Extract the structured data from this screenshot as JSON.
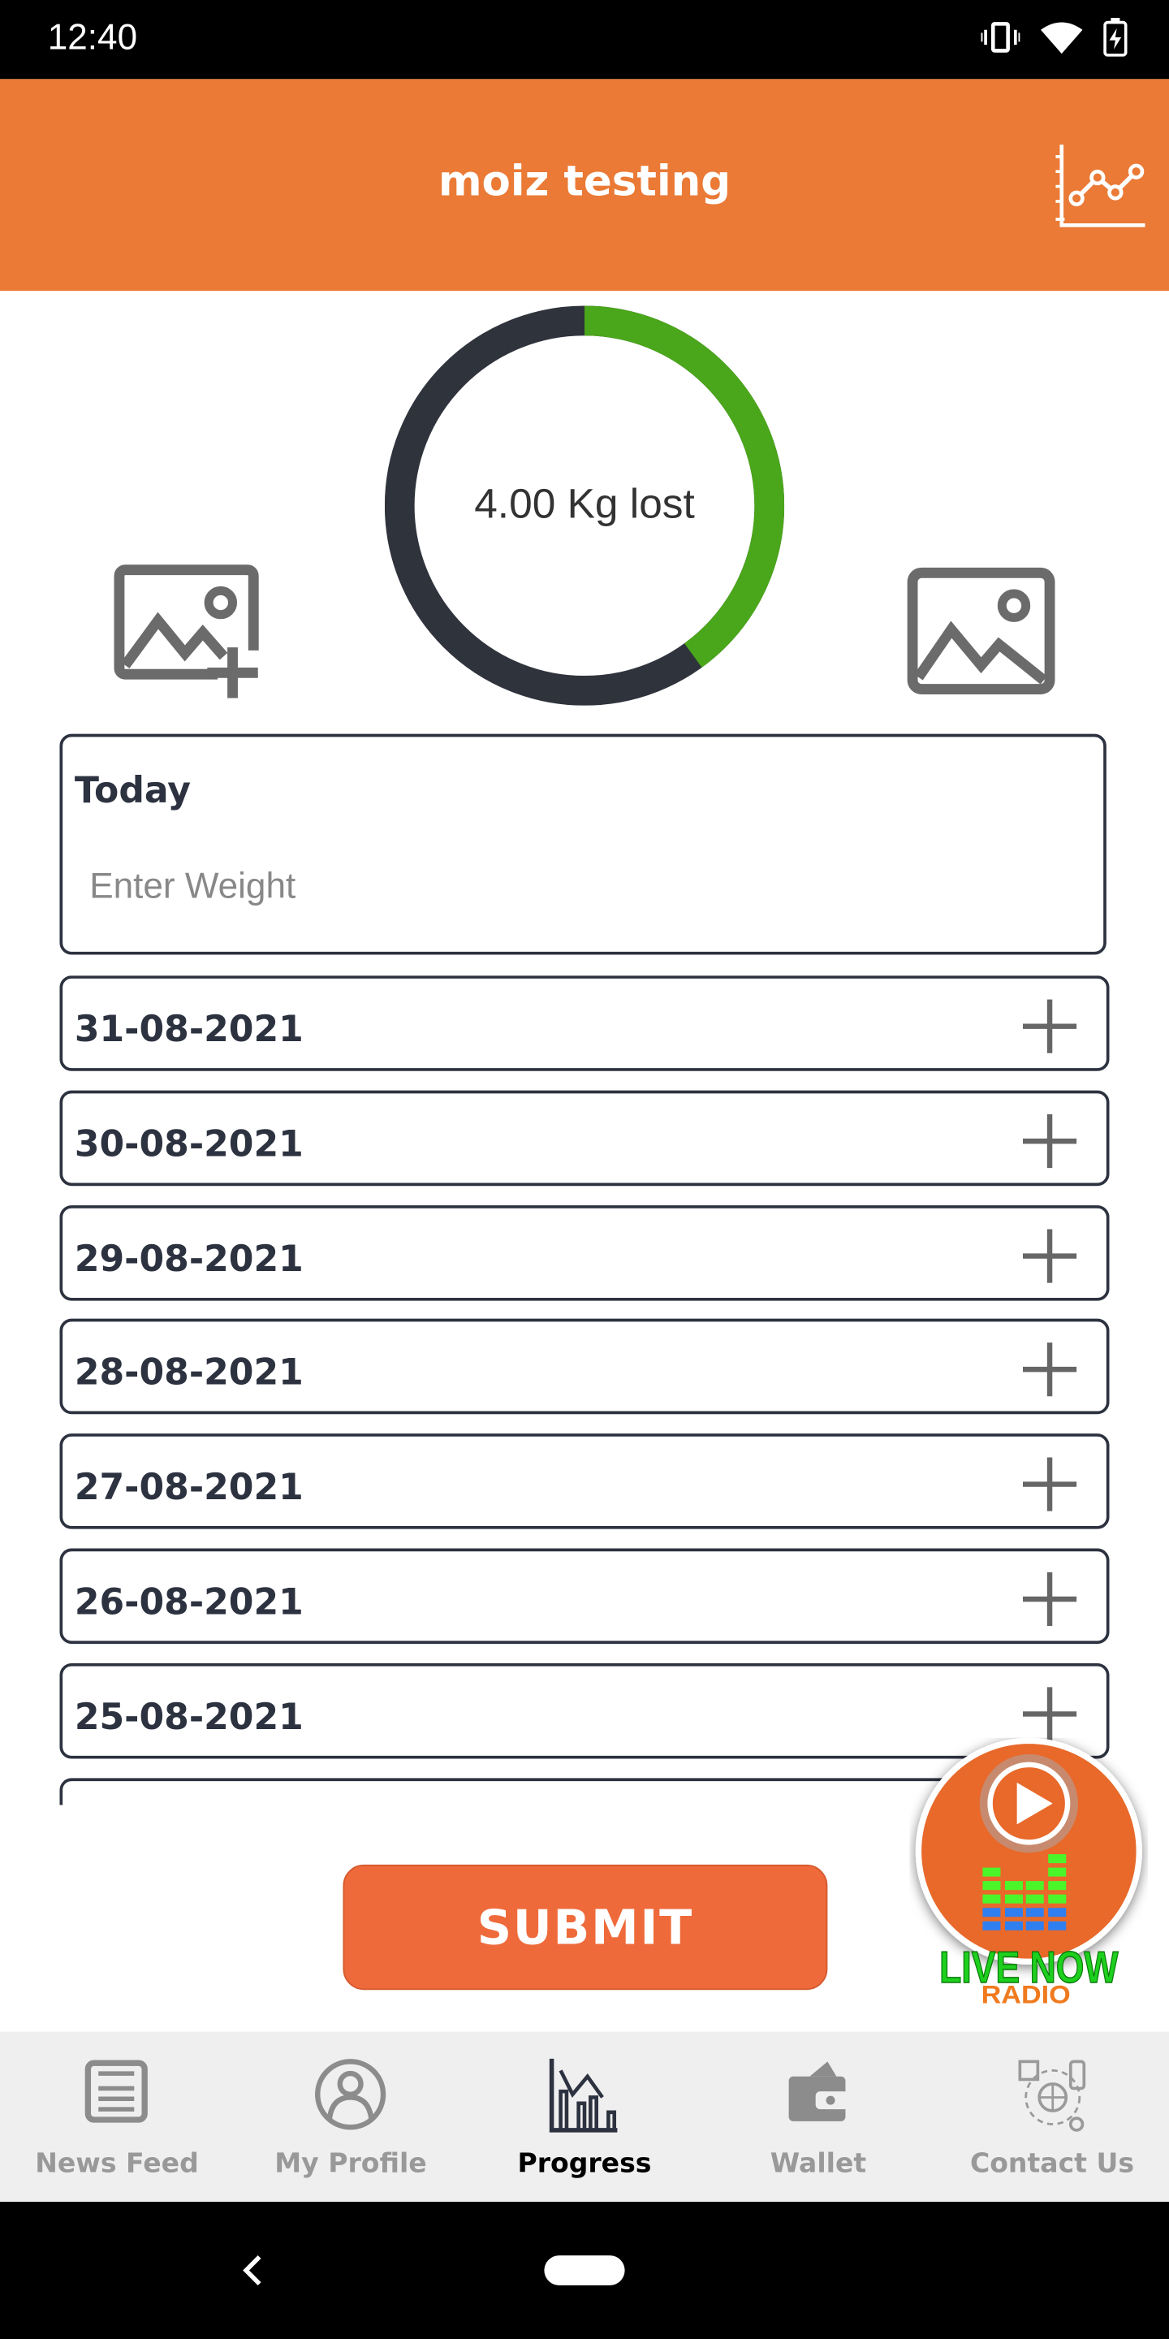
{
  "status_bar": {
    "time": "12:40",
    "icons": [
      "vibrate-icon",
      "wifi-icon",
      "battery-charging-icon"
    ]
  },
  "header": {
    "title": "moiz testing",
    "action_icon": "line-chart-icon"
  },
  "progress": {
    "label": "4.00 Kg lost",
    "fraction": 0.4,
    "progress_color": "#4aa61a",
    "track_color": "#2f333c"
  },
  "photos": {
    "add_icon": "add-photo-icon",
    "view_icon": "photo-icon"
  },
  "today": {
    "label": "Today",
    "placeholder": "Enter Weight",
    "value": ""
  },
  "entries": [
    {
      "date": "31-08-2021"
    },
    {
      "date": "30-08-2021"
    },
    {
      "date": "29-08-2021"
    },
    {
      "date": "28-08-2021"
    },
    {
      "date": "27-08-2021"
    },
    {
      "date": "26-08-2021"
    },
    {
      "date": "25-08-2021"
    },
    {
      "date": ""
    }
  ],
  "submit_label": "SUBMIT",
  "radio": {
    "line1": "LIVE NOW",
    "line2": "RADIO"
  },
  "nav": {
    "items": [
      {
        "label": "News Feed",
        "icon": "news-icon",
        "active": false
      },
      {
        "label": "My Profile",
        "icon": "profile-icon",
        "active": false
      },
      {
        "label": "Progress",
        "icon": "progress-chart-icon",
        "active": true
      },
      {
        "label": "Wallet",
        "icon": "wallet-icon",
        "active": false
      },
      {
        "label": "Contact Us",
        "icon": "contact-icon",
        "active": false
      }
    ]
  },
  "colors": {
    "header": "#ea7a36",
    "submit": "#ef6a3a",
    "nav_bg": "#efefef"
  }
}
